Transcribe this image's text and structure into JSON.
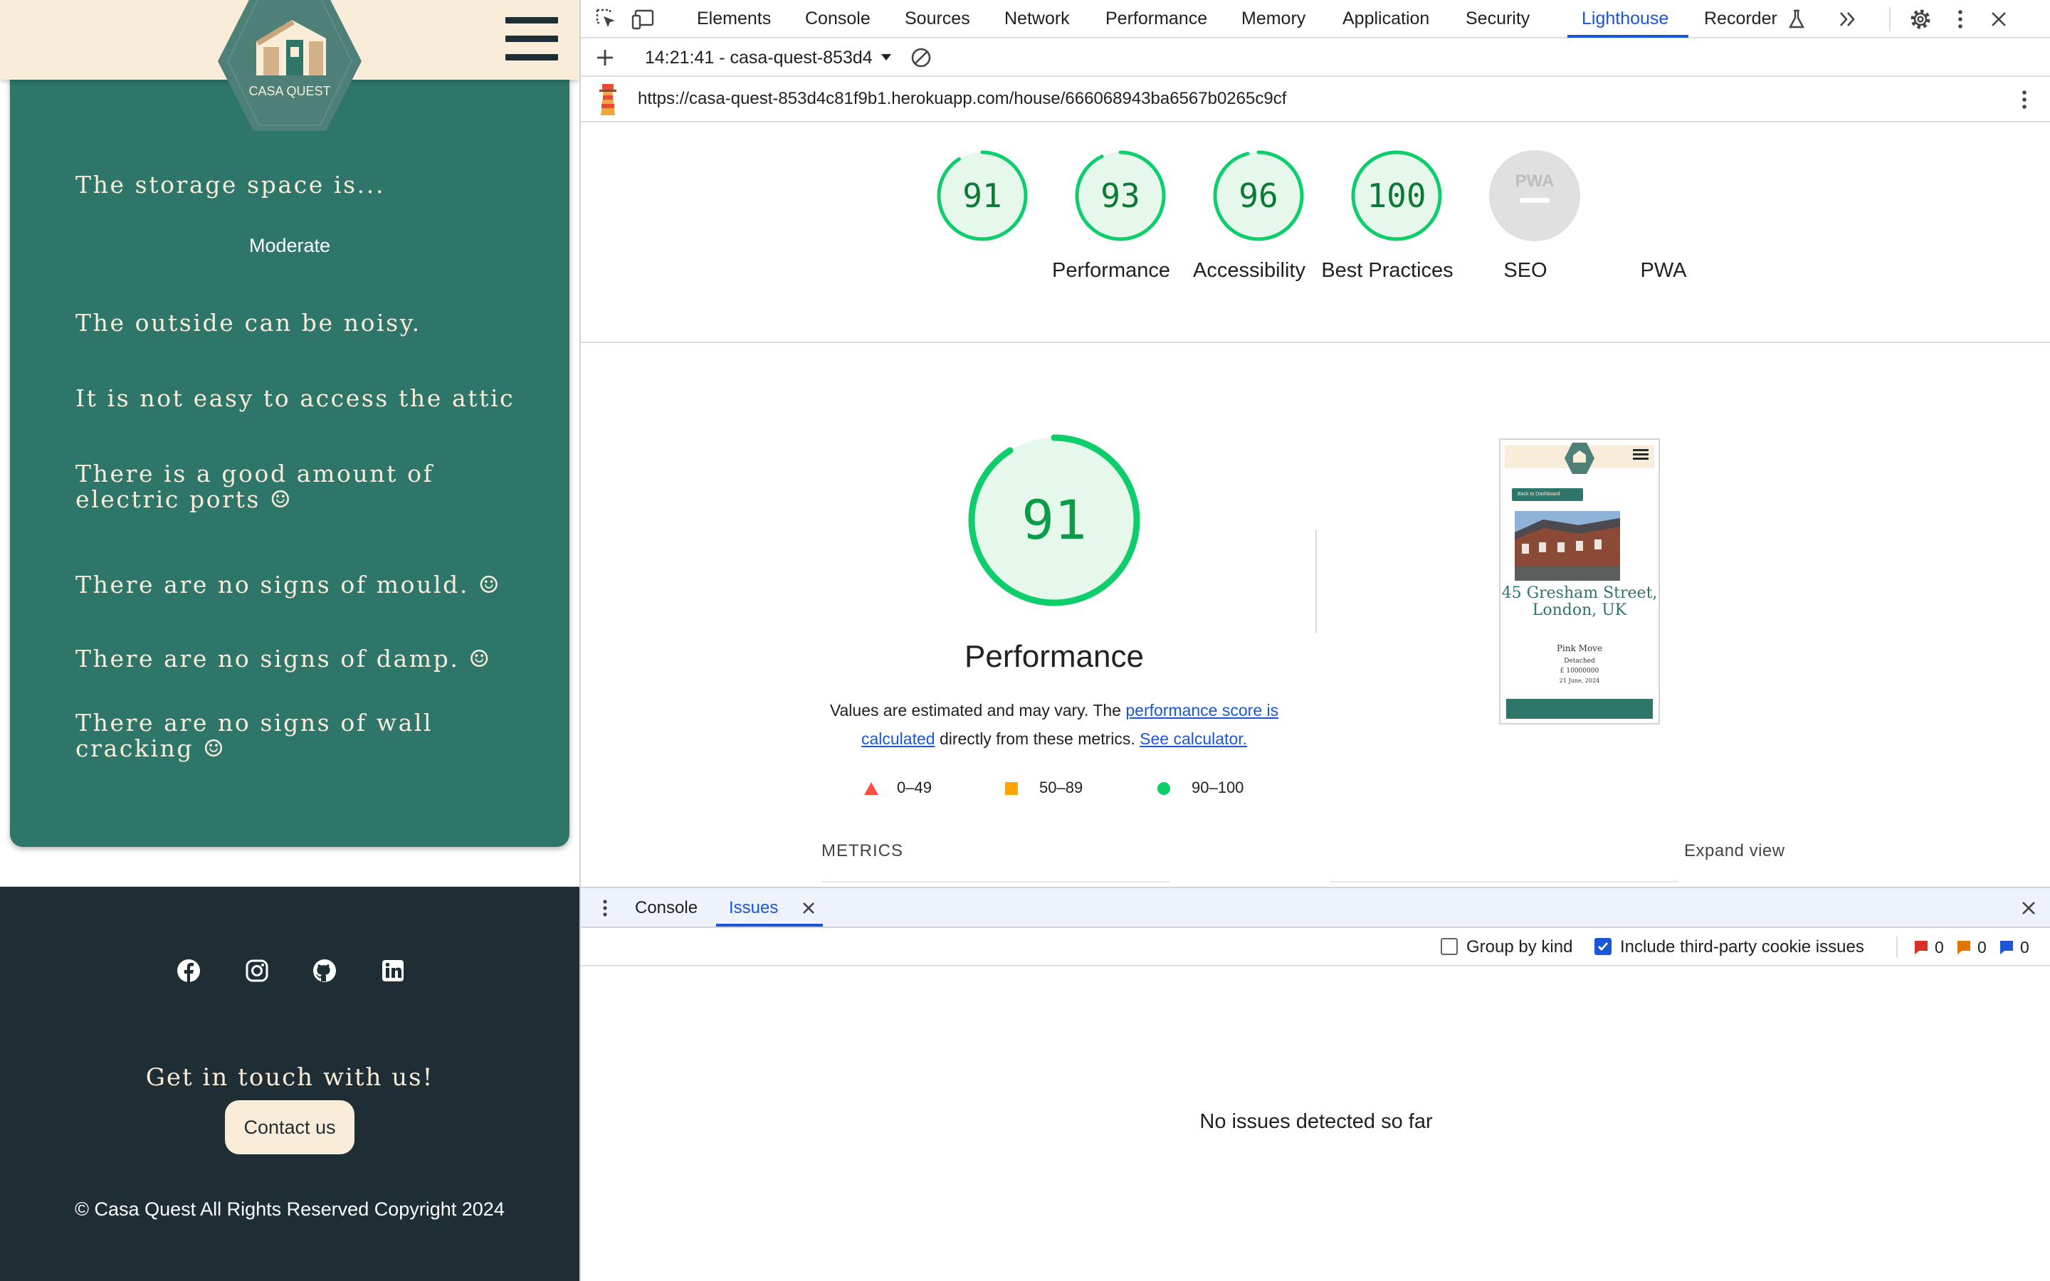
{
  "site": {
    "logo_text": "CASA QUEST",
    "inspection_items": [
      "The storage space is...",
      "The outside can be noisy.",
      "It is not easy to access the attic",
      "There is a good amount of electric ports ☺",
      "There are no signs of mould. ☺",
      "There are no signs of damp. ☺",
      "There are no signs of wall cracking ☺"
    ],
    "storage_value": "Moderate",
    "footer": {
      "social": [
        "facebook-icon",
        "instagram-icon",
        "github-icon",
        "linkedin-icon"
      ],
      "get_in_touch": "Get in touch with us!",
      "contact_button": "Contact us",
      "copyright": "© Casa Quest All Rights Reserved Copyright 2024"
    },
    "colors": {
      "primary": "#2e766a",
      "cream": "#f9ecd9",
      "dark": "#1f2e35"
    }
  },
  "devtools": {
    "tabs": [
      "Elements",
      "Console",
      "Sources",
      "Network",
      "Performance",
      "Memory",
      "Application",
      "Security",
      "Lighthouse",
      "Recorder"
    ],
    "active_tab": "Lighthouse",
    "report_select": "14:21:41 - casa-quest-853d4",
    "url": "https://casa-quest-853d4c81f9b1.herokuapp.com/house/666068943ba6567b0265c9cf",
    "scores": [
      {
        "label": "Performance",
        "value": 91
      },
      {
        "label": "Accessibility",
        "value": 93
      },
      {
        "label": "Best Practices",
        "value": 96
      },
      {
        "label": "SEO",
        "value": 100
      },
      {
        "label": "PWA",
        "value": null
      }
    ],
    "pwa_badge": "PWA",
    "performance": {
      "score": 91,
      "title": "Performance",
      "desc_1": "Values are estimated and may vary. The ",
      "link_1": "performance score is calculated",
      "desc_2": " directly from these metrics. ",
      "link_2": "See calculator.",
      "legend": [
        "0–49",
        "50–89",
        "90–100"
      ]
    },
    "thumbnail": {
      "back_button": "Back to Dashboard",
      "address": "45 Gresham Street, London, UK",
      "agent": "Pink Move",
      "type": "Detached",
      "price": "£ 10000000",
      "date": "21 June, 2024"
    },
    "metrics_label": "METRICS",
    "expand_view": "Expand view",
    "drawer": {
      "tabs": [
        "Console",
        "Issues"
      ],
      "active": "Issues",
      "group_by_kind": "Group by kind",
      "group_by_kind_checked": false,
      "third_party": "Include third-party cookie issues",
      "third_party_checked": true,
      "counts": {
        "errors": "0",
        "warnings": "0",
        "info": "0"
      },
      "empty_message": "No issues detected so far"
    },
    "score_colors": {
      "pass": "#0cce6b",
      "average": "#ffa400",
      "fail": "#ff4e42"
    }
  }
}
